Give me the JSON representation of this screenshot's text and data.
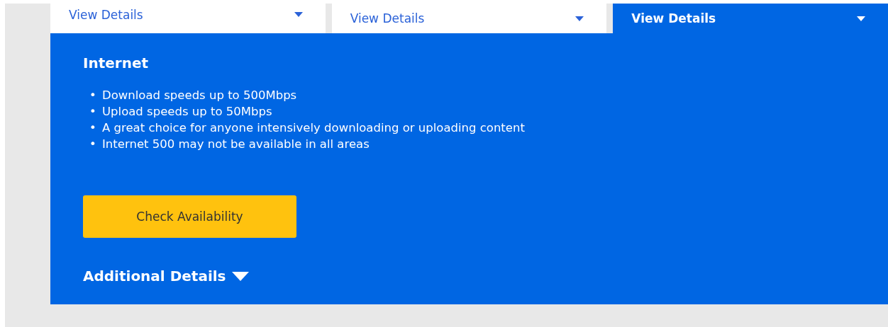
{
  "tabs": [
    {
      "label": "View Details",
      "selected": false
    },
    {
      "label": "View Details",
      "selected": false
    },
    {
      "label": "View Details",
      "selected": true
    }
  ],
  "panel": {
    "title": "Internet",
    "features": [
      {
        "bullet": "•",
        "text": "Download speeds up to 500Mbps"
      },
      {
        "bullet": "•",
        "text": "Upload speeds up to 50Mbps"
      },
      {
        "bullet": "•",
        "text": "A great choice for anyone intensively downloading or uploading content"
      },
      {
        "bullet": "•",
        "text": "Internet 500 may not be available in all areas"
      }
    ],
    "button": "Check Availability",
    "additional_details": "Additional Details"
  }
}
